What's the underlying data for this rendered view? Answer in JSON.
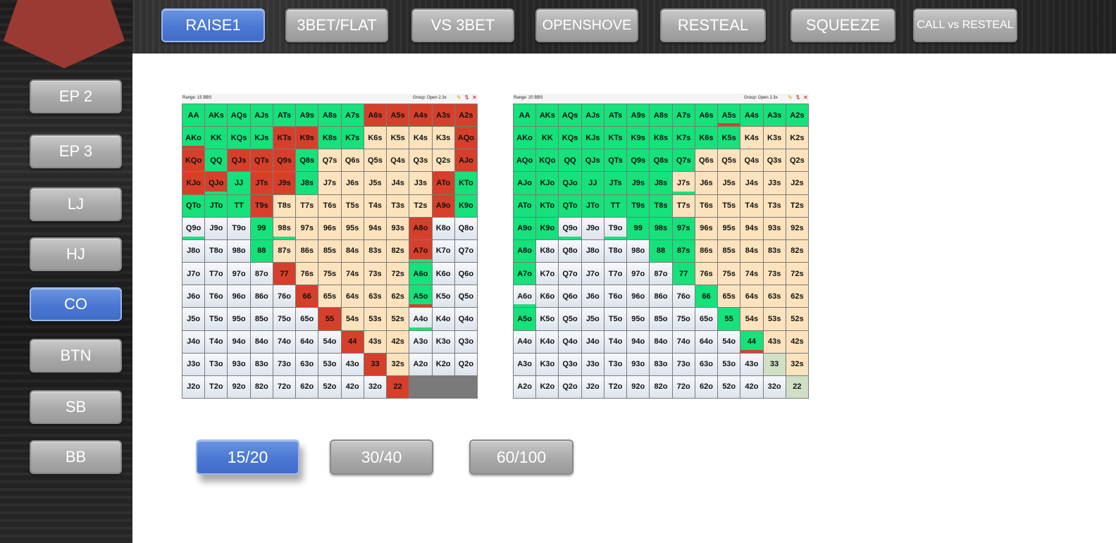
{
  "colors": {
    "accent": "#4a78d2",
    "button_gray": "#a9a9a9",
    "logo": "#9b3a33",
    "raise": "#15e27a",
    "fold": "#d6402b",
    "suited": "#fce3bd",
    "offsuit": "#e8edf3",
    "pair_alt": "#cfe0c4"
  },
  "top_tabs": [
    "RAISE1",
    "3BET/FLAT",
    "VS 3BET",
    "OPENSHOVE",
    "RESTEAL",
    "SQUEEZE",
    "CALL vs RESTEAL"
  ],
  "positions": [
    "EP 2",
    "EP 3",
    "LJ",
    "HJ",
    "CO",
    "BTN",
    "SB",
    "BB"
  ],
  "stack_sizes": [
    "15/20",
    "30/40",
    "60/100"
  ],
  "selected": {
    "tab": "RAISE1",
    "position": "CO",
    "stack": "15/20"
  },
  "ranges": [
    {
      "range_label": "Range: 15 BBS",
      "group_label": "Group: Open 2.3x",
      "rows": [
        "g g g g g g g g r r r r r",
        "gR g g g r r g gS s s s s",
        "r r g r r r g s s s s s s",
        "r r rG g r r g s s s s s",
        "r g g g g r s s s s s s s",
        "r g oG o o g sG s s s s s",
        "r o o o o o g s s s s s s",
        "rG o o o o o o r s s s s s",
        "g o o o o o o o r s s s s",
        "gR o o o o o o o o r s s s",
        "oG o o o o o o o o o r s s",
        "o o o o o o o o o o o r s",
        "o o o o o o o o o o o o r"
      ]
    },
    {
      "range_label": "Range: 20 BBS",
      "group_label": "Group: Open 2.3x",
      "rows": [
        "g g g g g g g g g gR g g g",
        "g g g g g g g g g g s s s",
        "g g g g g g g g s s s s s",
        "g g g g g g g sG s s s s s",
        "g g g g g g g s s s s s s",
        "g g oG o oG g g gS s s s s s",
        "g o o o o o g g s s s s s",
        "g o o o o o o g s s s s s",
        "oG o o o o o o o g s s s s",
        "g o o o o o o o o g s s s",
        "o o o o o o o o o o gR s s",
        "o o o o o o o o o o o p s",
        "o o o o o o o o o o o o p"
      ]
    }
  ]
}
